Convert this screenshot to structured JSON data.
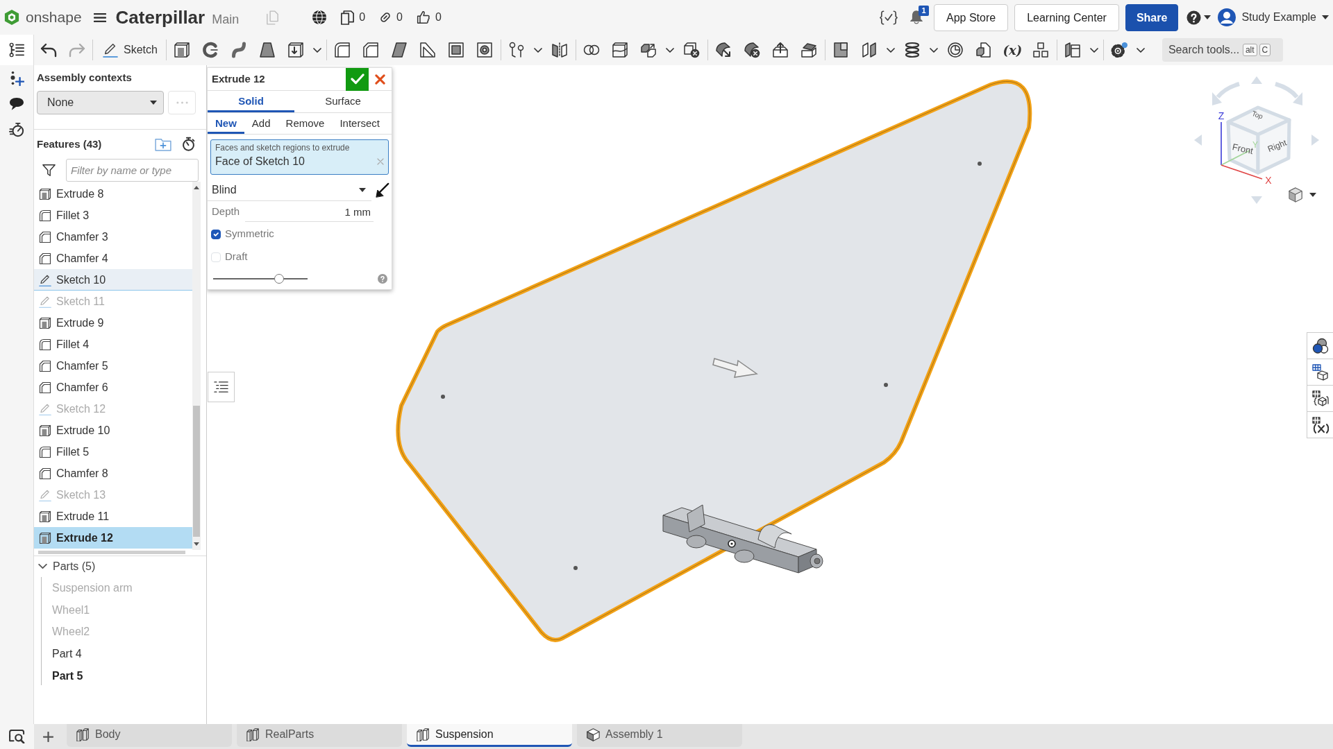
{
  "top_bar": {
    "logo_text": "onshape",
    "document_title": "Caterpillar",
    "branch": "Main",
    "counters": [
      {
        "kind": "versions",
        "value": "0"
      },
      {
        "kind": "links",
        "value": "0"
      },
      {
        "kind": "likes",
        "value": "0"
      }
    ],
    "notification_badge": "1",
    "buttons": [
      {
        "label": "App Store",
        "kind": "outline"
      },
      {
        "label": "Learning Center",
        "kind": "outline"
      },
      {
        "label": "Share",
        "kind": "primary"
      }
    ],
    "user_name": "Study Example"
  },
  "toolbar": {
    "sketch_label": "Sketch",
    "variable_label": "(x)",
    "search": {
      "placeholder": "Search tools...",
      "shortcut": [
        "alt",
        "C"
      ]
    }
  },
  "assembly_contexts": {
    "label": "Assembly contexts",
    "value": "None"
  },
  "features": {
    "title": "Features (43)",
    "filter_placeholder": "Filter by name or type",
    "items": [
      {
        "name": "Extrude 8",
        "kind": "extrude",
        "selected": false,
        "highlighted": false,
        "hidden": false
      },
      {
        "name": "Fillet 3",
        "kind": "fillet",
        "selected": false,
        "highlighted": false,
        "hidden": false
      },
      {
        "name": "Chamfer 3",
        "kind": "chamfer",
        "selected": false,
        "highlighted": false,
        "hidden": false
      },
      {
        "name": "Chamfer 4",
        "kind": "chamfer",
        "selected": false,
        "highlighted": false,
        "hidden": false
      },
      {
        "name": "Sketch 10",
        "kind": "sketch",
        "selected": false,
        "highlighted": true,
        "hidden": false
      },
      {
        "name": "Sketch 11",
        "kind": "sketch",
        "selected": false,
        "highlighted": false,
        "hidden": true
      },
      {
        "name": "Extrude 9",
        "kind": "extrude",
        "selected": false,
        "highlighted": false,
        "hidden": false
      },
      {
        "name": "Fillet 4",
        "kind": "fillet",
        "selected": false,
        "highlighted": false,
        "hidden": false
      },
      {
        "name": "Chamfer 5",
        "kind": "chamfer",
        "selected": false,
        "highlighted": false,
        "hidden": false
      },
      {
        "name": "Chamfer 6",
        "kind": "chamfer",
        "selected": false,
        "highlighted": false,
        "hidden": false
      },
      {
        "name": "Sketch 12",
        "kind": "sketch",
        "selected": false,
        "highlighted": false,
        "hidden": true
      },
      {
        "name": "Extrude 10",
        "kind": "extrude",
        "selected": false,
        "highlighted": false,
        "hidden": false
      },
      {
        "name": "Fillet 5",
        "kind": "fillet",
        "selected": false,
        "highlighted": false,
        "hidden": false
      },
      {
        "name": "Chamfer 8",
        "kind": "chamfer",
        "selected": false,
        "highlighted": false,
        "hidden": false
      },
      {
        "name": "Sketch 13",
        "kind": "sketch",
        "selected": false,
        "highlighted": false,
        "hidden": true
      },
      {
        "name": "Extrude 11",
        "kind": "extrude",
        "selected": false,
        "highlighted": false,
        "hidden": false
      },
      {
        "name": "Extrude 12",
        "kind": "extrude",
        "selected": true,
        "highlighted": false,
        "hidden": false
      }
    ]
  },
  "parts": {
    "title": "Parts (5)",
    "expanded": true,
    "items": [
      {
        "name": "Suspension arm",
        "selected": false,
        "hidden": true
      },
      {
        "name": "Wheel1",
        "selected": false,
        "hidden": true
      },
      {
        "name": "Wheel2",
        "selected": false,
        "hidden": true
      },
      {
        "name": "Part 4",
        "selected": false,
        "hidden": false
      },
      {
        "name": "Part 5",
        "selected": true,
        "hidden": false
      }
    ]
  },
  "feature_dialog": {
    "title": "Extrude 12",
    "body_tabs": [
      {
        "label": "Solid",
        "selected": true
      },
      {
        "label": "Surface",
        "selected": false
      }
    ],
    "operation_tabs": [
      {
        "label": "New",
        "selected": true
      },
      {
        "label": "Add",
        "selected": false
      },
      {
        "label": "Remove",
        "selected": false
      },
      {
        "label": "Intersect",
        "selected": false
      }
    ],
    "selection": {
      "label": "Faces and sketch regions to extrude",
      "value": "Face of Sketch 10"
    },
    "end_type": "Blind",
    "depth": {
      "label": "Depth",
      "value": "1 mm"
    },
    "options": [
      {
        "label": "Symmetric",
        "checked": true
      },
      {
        "label": "Draft",
        "checked": false
      }
    ],
    "preview_slider": {
      "level": 0.7
    }
  },
  "view_cube": {
    "faces": [
      "Top",
      "Front",
      "Right"
    ],
    "axes": [
      {
        "label": "Z",
        "color": "#3c3cd8"
      },
      {
        "label": "Y",
        "color": "#a3d69b"
      },
      {
        "label": "X",
        "color": "#e04646"
      }
    ]
  },
  "tabs": [
    {
      "label": "Body",
      "kind": "part_studio",
      "selected": false
    },
    {
      "label": "RealParts",
      "kind": "part_studio",
      "selected": false
    },
    {
      "label": "Suspension",
      "kind": "part_studio",
      "selected": true
    },
    {
      "label": "Assembly 1",
      "kind": "assembly",
      "selected": false
    }
  ]
}
